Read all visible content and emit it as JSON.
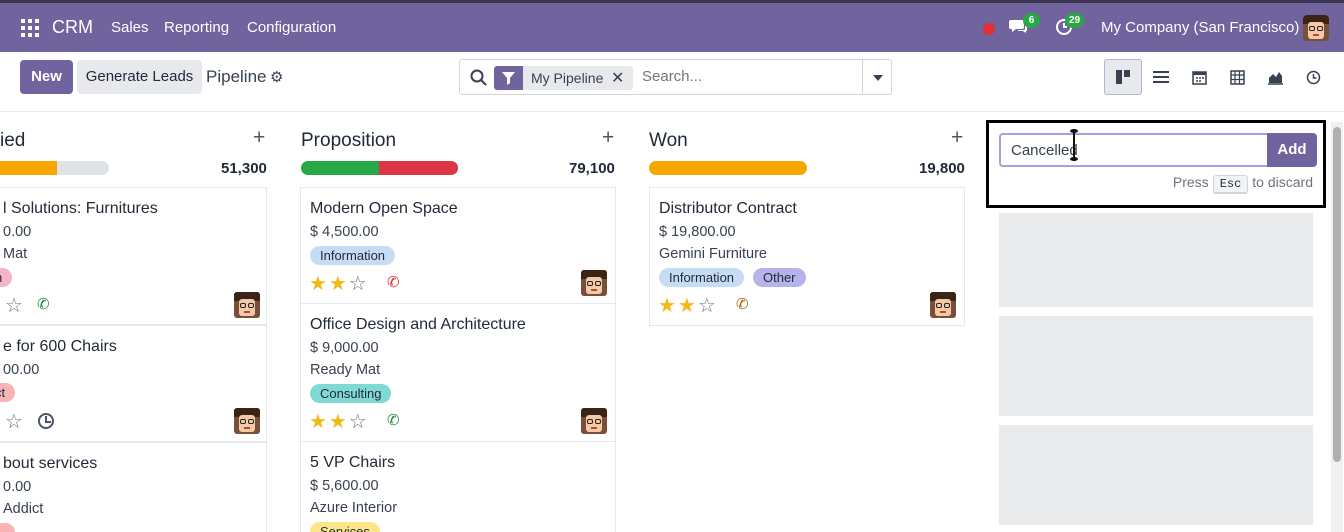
{
  "topbar": {
    "app_name": "CRM",
    "menu": [
      "Sales",
      "Reporting",
      "Configuration"
    ],
    "messages_count": "6",
    "activities_count": "29",
    "company": "My Company (San Francisco)"
  },
  "control": {
    "new_label": "New",
    "generate_label": "Generate Leads",
    "breadcrumb": "Pipeline",
    "search": {
      "facet_label": "My Pipeline",
      "placeholder": "Search..."
    },
    "views": [
      "kanban-icon",
      "list-icon",
      "calendar-icon",
      "pivot-icon",
      "graph-icon",
      "activity-icon"
    ]
  },
  "columns": [
    {
      "name": "Qualified",
      "visible_name": "ied",
      "total": "51,300",
      "cards": [
        {
          "title": "l Solutions: Furnitures",
          "amount": "0.00",
          "company": "Mat",
          "tag": "n",
          "stars": 1,
          "activity": "phone-icon",
          "activity_color": "#1e8a3a"
        },
        {
          "title": "e for 600 Chairs",
          "amount": "00.00",
          "company": "",
          "tag": "ct",
          "stars": 1,
          "activity": "clock-icon",
          "activity_color": "#4b5563"
        },
        {
          "title": "bout services",
          "amount": "0.00",
          "company": "Addict",
          "tag": "",
          "stars": 1,
          "activity": "",
          "activity_color": ""
        }
      ]
    },
    {
      "name": "Proposition",
      "total": "79,100",
      "cards": [
        {
          "title": "Modern Open Space",
          "amount": "$ 4,500.00",
          "company": "",
          "tag": "Information",
          "stars": 2,
          "activity": "phone-icon",
          "activity_color": "#e03131"
        },
        {
          "title": "Office Design and Architecture",
          "amount": "$ 9,000.00",
          "company": "Ready Mat",
          "tag": "Consulting",
          "stars": 2,
          "activity": "phone-icon",
          "activity_color": "#1e8a3a"
        },
        {
          "title": "5 VP Chairs",
          "amount": "$ 5,600.00",
          "company": "Azure Interior",
          "tag": "Services",
          "stars": 0,
          "activity": "",
          "activity_color": ""
        }
      ]
    },
    {
      "name": "Won",
      "total": "19,800",
      "cards": [
        {
          "title": "Distributor Contract",
          "amount": "$ 19,800.00",
          "company": "Gemini Furniture",
          "tags": [
            "Information",
            "Other"
          ],
          "stars": 2,
          "activity": "phone-icon",
          "activity_color": "#a16207"
        }
      ]
    }
  ],
  "new_column": {
    "value": "Cancelled",
    "add_label": "Add",
    "hint_press": "Press",
    "hint_key": "Esc",
    "hint_after": "to discard"
  },
  "colors": {
    "brand": "#71639e",
    "progress_green": "#28a745",
    "progress_red": "#dc3545",
    "progress_orange": "#f7a600",
    "tag_information": "#c6dcf4",
    "tag_consulting": "#7fd9d5",
    "tag_services": "#fde68a",
    "tag_other": "#b6b3ea",
    "tag_pink": "#f3b4cc",
    "tag_red": "#f8b4b4"
  }
}
